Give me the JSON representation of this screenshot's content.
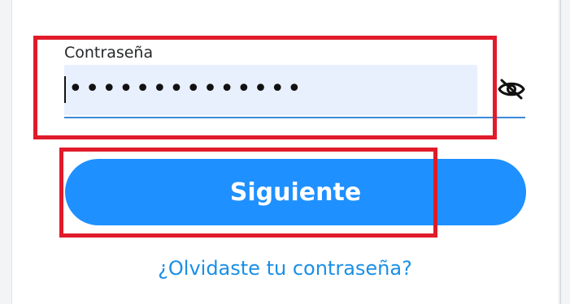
{
  "password_field": {
    "label": "Contraseña",
    "value_masked": "••••••••••••••",
    "visibility_toggle_icon": "eye-slash-icon"
  },
  "submit": {
    "label": "Siguiente",
    "color": "#1f90ff"
  },
  "forgot_password": {
    "label": "¿Olvidaste tu contraseña?",
    "color": "#1a8fe5"
  },
  "highlights": {
    "color": "#e01b2a"
  }
}
